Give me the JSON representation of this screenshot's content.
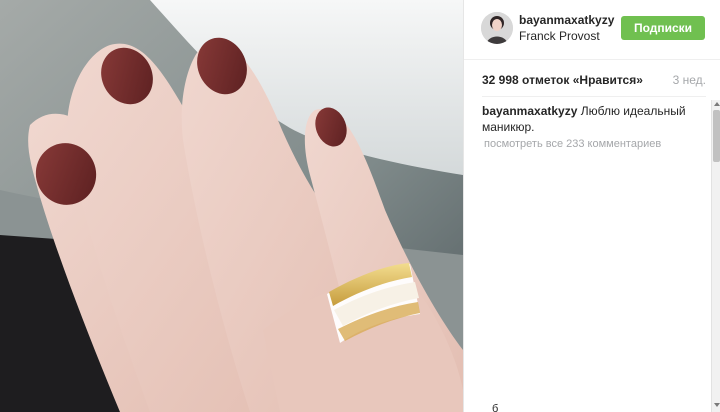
{
  "post": {
    "image_description_icon": "photo",
    "author": {
      "username": "bayanmaxatkyzy",
      "location": "Franck Provost",
      "avatar_icon": "user-avatar"
    },
    "follow_label": "Подписки",
    "likes": "32 998 отметок «Нравится»",
    "time": "3 нед.",
    "caption": {
      "username": "bayanmaxatkyzy",
      "text": "Люблю идеальный маникюр."
    },
    "view_comments": "посмотреть все 233 комментариев",
    "partial_comment": "б"
  },
  "colors": {
    "follow_button": "#70c050",
    "nail_polish": "#6e2a2a",
    "muted_text": "#a5a7aa"
  }
}
